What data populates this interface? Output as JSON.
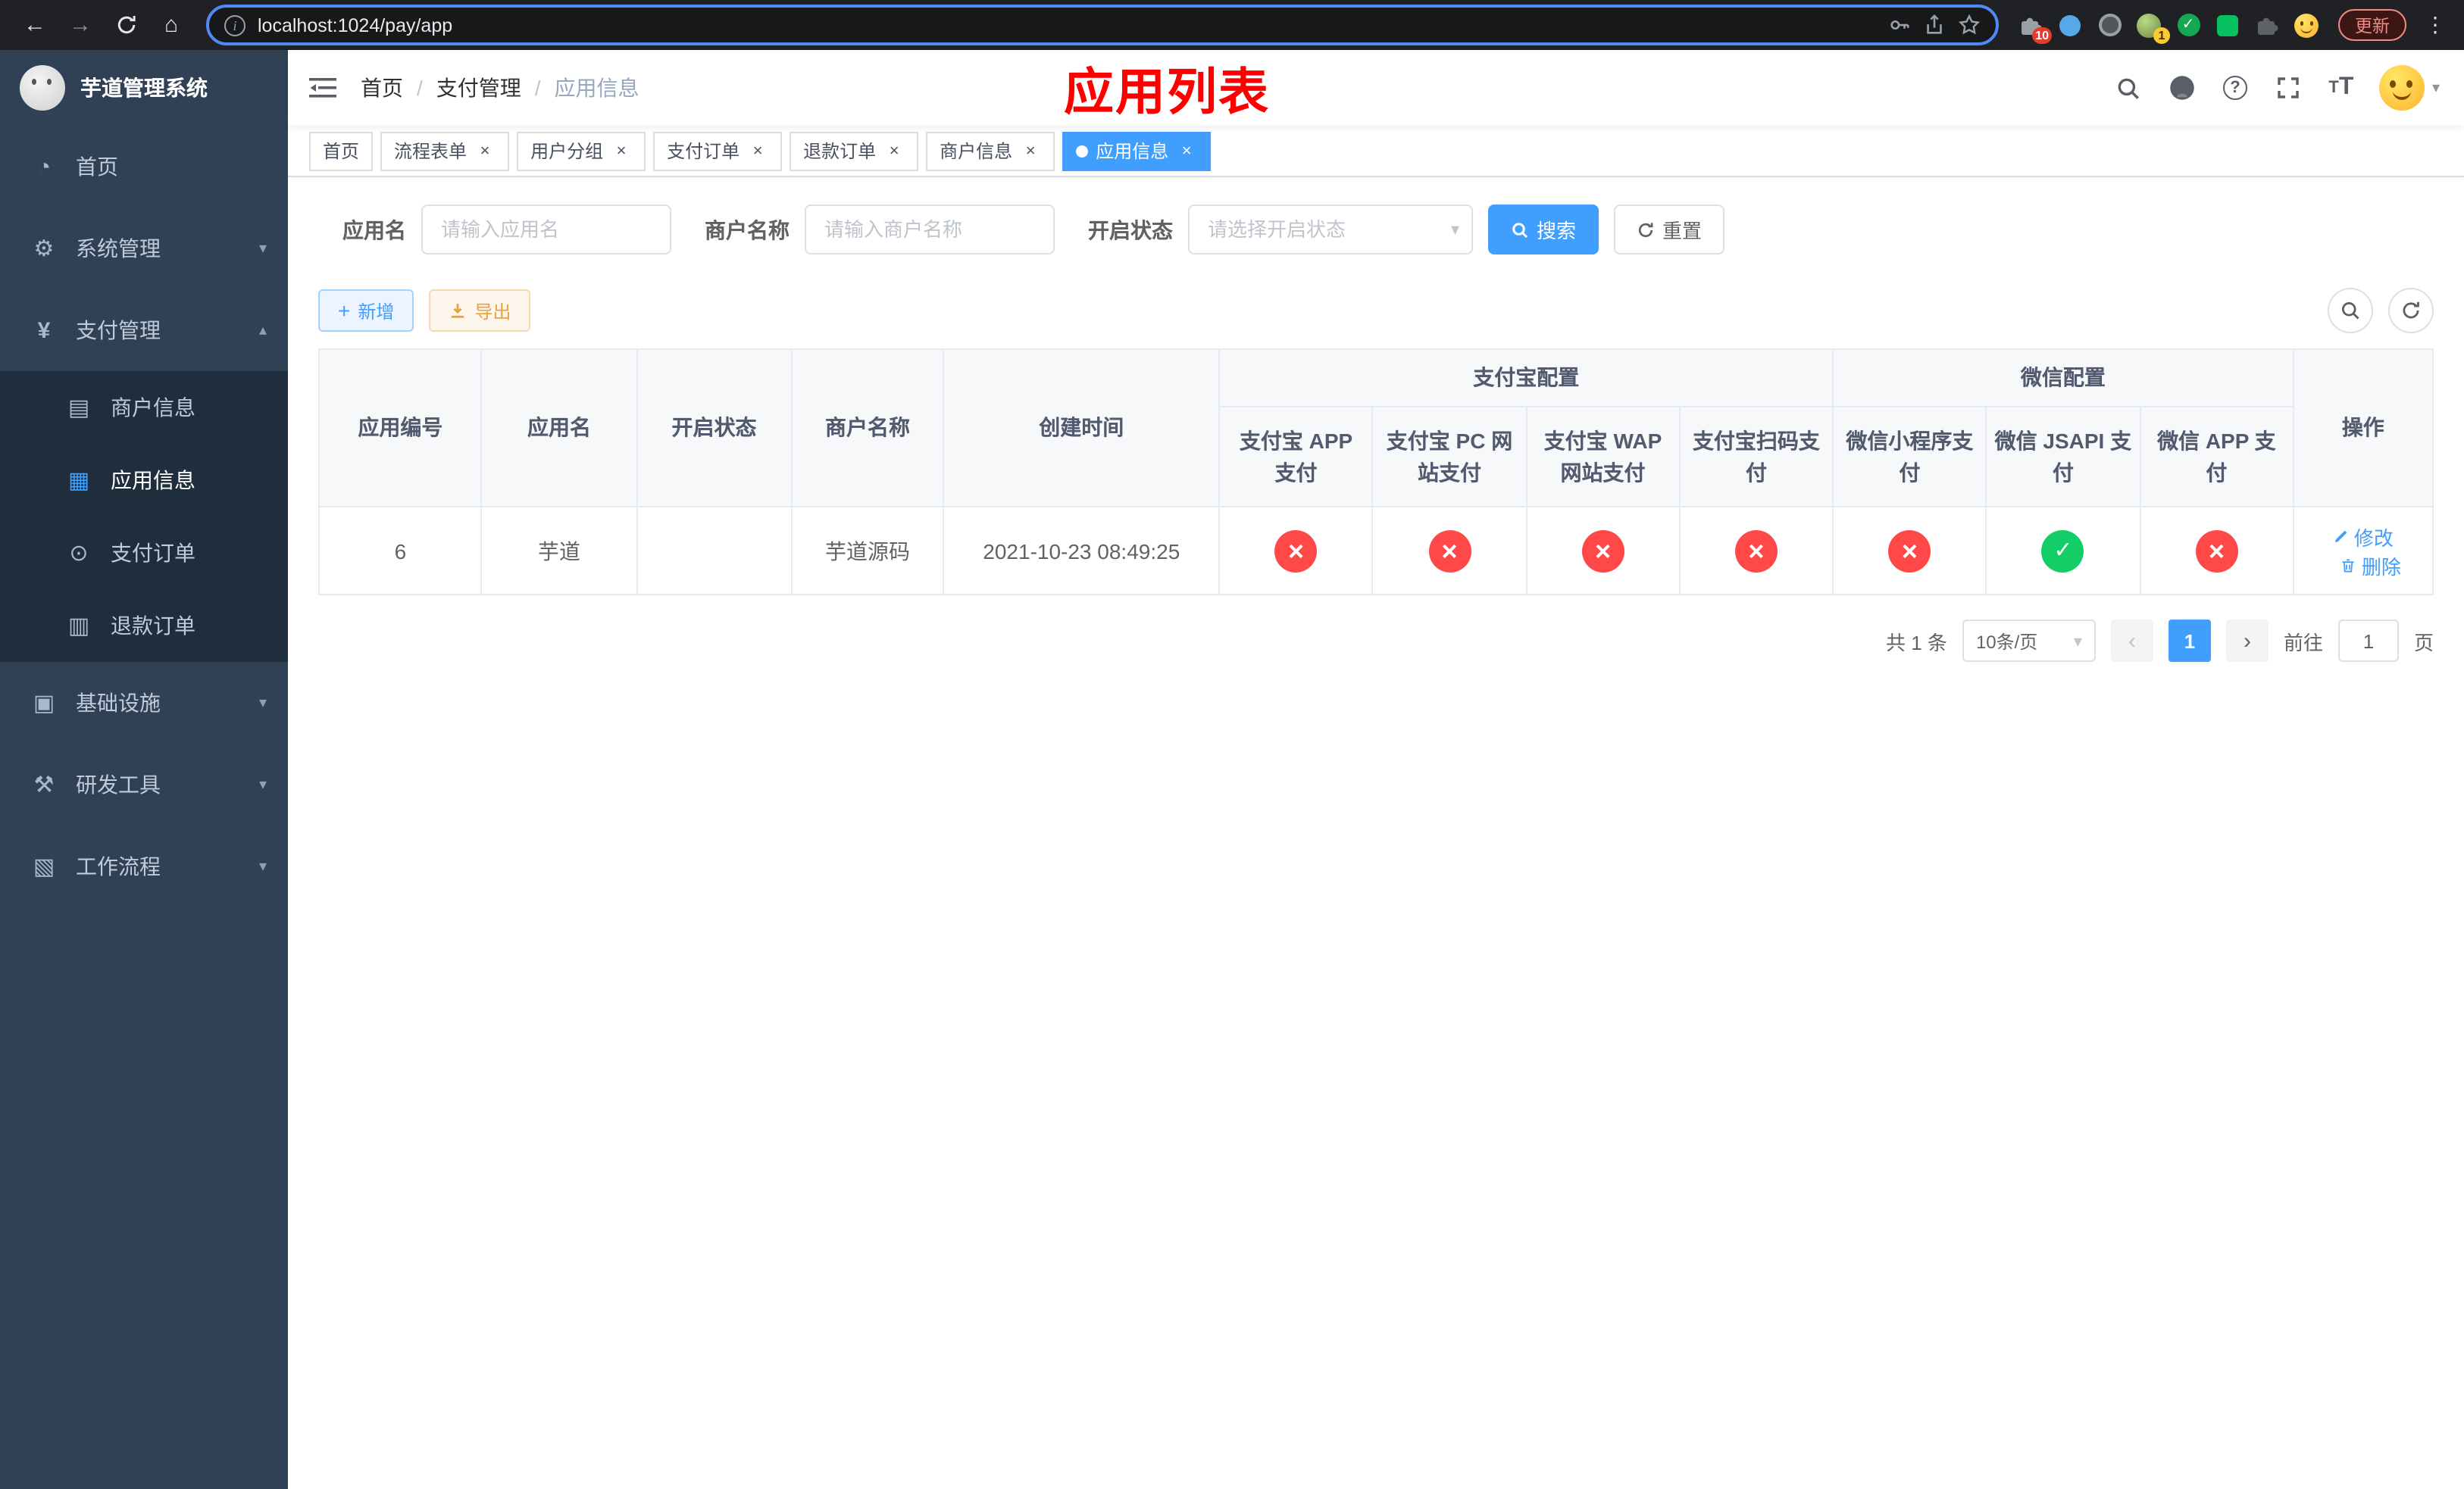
{
  "browser": {
    "url": "localhost:1024/pay/app",
    "update_button": "更新",
    "puzzle_badge": "10",
    "avatar_badge": "1"
  },
  "sidebar": {
    "title": "芋道管理系统",
    "items": [
      {
        "label": "首页"
      },
      {
        "label": "系统管理"
      },
      {
        "label": "支付管理",
        "children": [
          {
            "label": "商户信息"
          },
          {
            "label": "应用信息"
          },
          {
            "label": "支付订单"
          },
          {
            "label": "退款订单"
          }
        ]
      },
      {
        "label": "基础设施"
      },
      {
        "label": "研发工具"
      },
      {
        "label": "工作流程"
      }
    ]
  },
  "navbar": {
    "breadcrumb": [
      "首页",
      "支付管理",
      "应用信息"
    ],
    "page_title": "应用列表"
  },
  "tabs": [
    {
      "label": "首页",
      "closable": false,
      "active": false
    },
    {
      "label": "流程表单",
      "closable": true,
      "active": false
    },
    {
      "label": "用户分组",
      "closable": true,
      "active": false
    },
    {
      "label": "支付订单",
      "closable": true,
      "active": false
    },
    {
      "label": "退款订单",
      "closable": true,
      "active": false
    },
    {
      "label": "商户信息",
      "closable": true,
      "active": false
    },
    {
      "label": "应用信息",
      "closable": true,
      "active": true
    }
  ],
  "filters": {
    "app_name_label": "应用名",
    "app_name_placeholder": "请输入应用名",
    "merchant_label": "商户名称",
    "merchant_placeholder": "请输入商户名称",
    "status_label": "开启状态",
    "status_placeholder": "请选择开启状态",
    "search_button": "搜索",
    "reset_button": "重置"
  },
  "toolbar": {
    "add_button": "新增",
    "export_button": "导出"
  },
  "table": {
    "headers": {
      "app_id": "应用编号",
      "app_name": "应用名",
      "status": "开启状态",
      "merchant": "商户名称",
      "created": "创建时间",
      "alipay_group": "支付宝配置",
      "wechat_group": "微信配置",
      "alipay_app": "支付宝 APP 支付",
      "alipay_pc": "支付宝 PC 网站支付",
      "alipay_wap": "支付宝 WAP 网站支付",
      "alipay_qr": "支付宝扫码支付",
      "wx_mini": "微信小程序支付",
      "wx_jsapi": "微信 JSAPI 支付",
      "wx_app": "微信 APP 支付",
      "actions": "操作"
    },
    "row": {
      "id": "6",
      "app_name": "芋道",
      "status_on": true,
      "merchant": "芋道源码",
      "created": "2021-10-23 08:49:25",
      "configs": [
        "no",
        "no",
        "no",
        "no",
        "no",
        "yes",
        "no"
      ],
      "edit_label": "修改",
      "delete_label": "删除"
    }
  },
  "pagination": {
    "total": "共 1 条",
    "page_size": "10条/页",
    "page": "1",
    "goto_label": "前往",
    "goto_value": "1",
    "unit_label": "页"
  },
  "colors": {
    "primary": "#409eff",
    "status_no": "#ff4949",
    "status_yes": "#13ce66",
    "title_red": "#ff0000",
    "warning": "#e6a23c"
  }
}
